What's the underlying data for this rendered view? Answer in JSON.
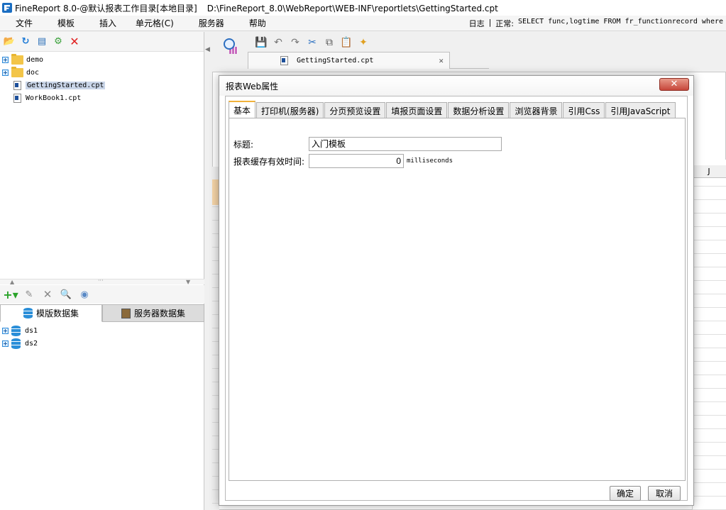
{
  "window": {
    "title": "FineReport 8.0-@默认报表工作目录[本地目录]",
    "path": "D:\\FineReport_8.0\\WebReport\\WEB-INF\\reportlets\\GettingStarted.cpt"
  },
  "menubar": {
    "items": [
      "文件",
      "模板",
      "插入",
      "单元格(C)",
      "服务器",
      "帮助"
    ],
    "log_label": "日志",
    "log_separator": "|",
    "log_status": "正常:",
    "log_sql": "SELECT func,logtime FROM fr_functionrecord where"
  },
  "file_tree": {
    "items": [
      {
        "name": "demo",
        "type": "folder"
      },
      {
        "name": "doc",
        "type": "folder"
      },
      {
        "name": "GettingStarted.cpt",
        "type": "file",
        "selected": true
      },
      {
        "name": "WorkBook1.cpt",
        "type": "file"
      }
    ]
  },
  "datasets": {
    "tabs": [
      "模版数据集",
      "服务器数据集"
    ],
    "items": [
      "ds1",
      "ds2"
    ]
  },
  "designer": {
    "doc_tab": "GettingStarted.cpt",
    "column_label": "J"
  },
  "dialog": {
    "title": "报表Web属性",
    "tabs": [
      "基本",
      "打印机(服务器)",
      "分页预览设置",
      "填报页面设置",
      "数据分析设置",
      "浏览器背景",
      "引用Css",
      "引用JavaScript"
    ],
    "fields": {
      "title_label": "标题:",
      "title_value": "入门模板",
      "cache_label": "报表缓存有效时间:",
      "cache_value": "0",
      "cache_unit": "milliseconds"
    },
    "ok_label": "确定",
    "cancel_label": "取消"
  }
}
